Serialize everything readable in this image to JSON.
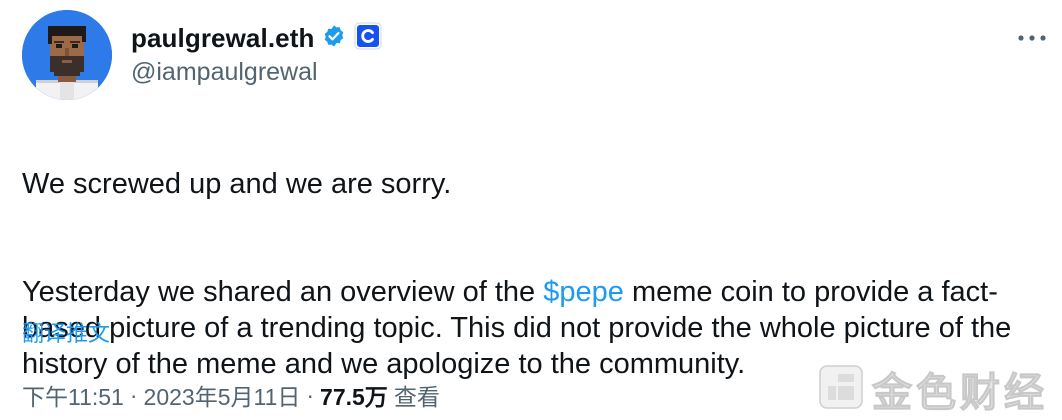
{
  "author": {
    "display_name": "paulgrewal.eth",
    "handle": "@iampaulgrewal",
    "avatar_icon": "pixel-art-avatar",
    "verified_icon": "verified-badge-icon",
    "affiliate_icon": "coinbase-logo-icon"
  },
  "tweet": {
    "paragraph1": "We screwed up and we are sorry.",
    "paragraph2_before": "Yesterday we shared an overview of the ",
    "cashtag": "$pepe",
    "paragraph2_after": " meme coin to provide a fact-based picture of a trending topic. This did not provide the whole picture of the history of the meme and we apologize to the community.",
    "translate_label": "翻译推文"
  },
  "meta": {
    "time": "下午11:51",
    "separator": "·",
    "date": "2023年5月11日",
    "views_count": "77.5万",
    "views_label": "查看"
  },
  "watermark": {
    "text": "金色财经",
    "logo_icon": "jinse-logo-icon"
  },
  "colors": {
    "link": "#1d9bf0",
    "secondary_text": "#536471",
    "primary_text": "#0f1419",
    "avatar_bg": "#2e7ae8",
    "coinbase_blue": "#1652f0"
  }
}
